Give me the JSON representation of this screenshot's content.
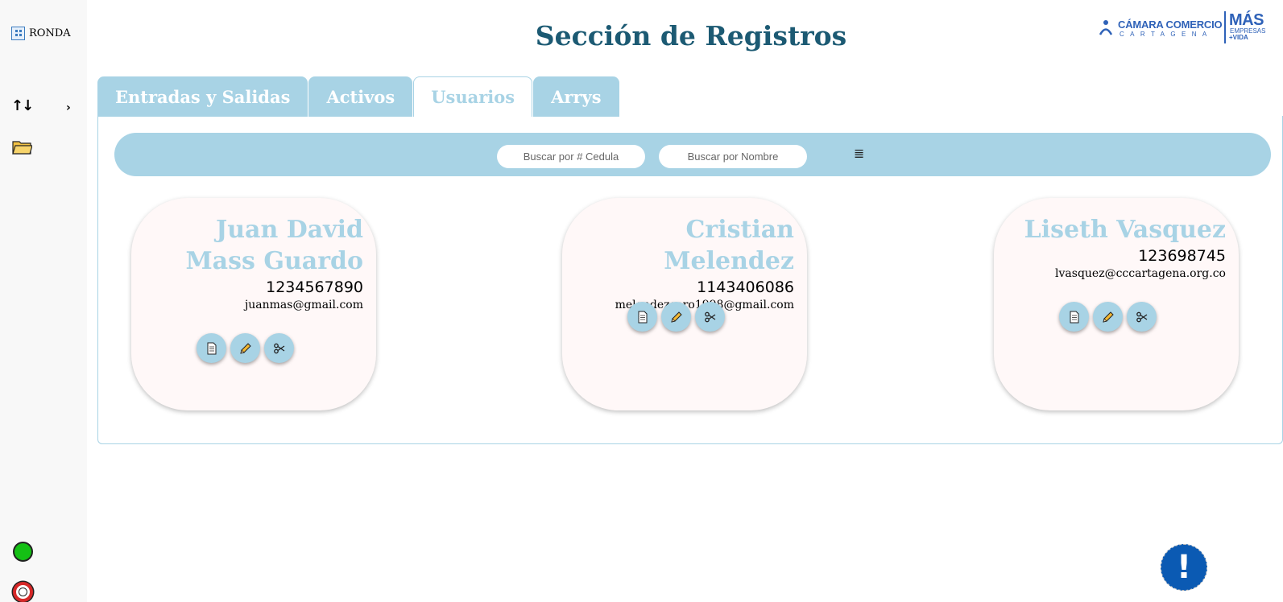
{
  "app": {
    "brand": "RONDA"
  },
  "header": {
    "title": "Sección de Registros"
  },
  "logo": {
    "line1": "CÁMARA COMERCIO",
    "line2": "CARTAGENA",
    "mas": "MÁS",
    "empresas": "EMPRESAS",
    "vida": "+VIDA"
  },
  "sidebar": {
    "items": [
      {
        "icon": "up-down-arrows-icon",
        "chevron": "›"
      },
      {
        "icon": "folder-icon"
      }
    ],
    "status": [
      {
        "icon": "status-green-icon",
        "color": "#14c014"
      },
      {
        "icon": "record-icon",
        "color": "#d62828"
      }
    ]
  },
  "tabs": [
    {
      "label": "Entradas y Salidas",
      "active": false
    },
    {
      "label": "Activos",
      "active": false
    },
    {
      "label": "Usuarios",
      "active": true
    },
    {
      "label": "Arrys",
      "active": false
    }
  ],
  "search": {
    "cedula_placeholder": "Buscar por # Cedula",
    "nombre_placeholder": "Buscar por Nombre",
    "filter_icon": "≣"
  },
  "users": [
    {
      "name": "Juan David Mass Guardo",
      "id": "1234567890",
      "email": "juanmas@gmail.com"
    },
    {
      "name": "Cristian Melendez",
      "id": "1143406086",
      "email": "melendezcaro1998@gmail.com"
    },
    {
      "name": "Liseth Vasquez",
      "id": "123698745",
      "email": "lvasquez@cccartagena.org.co"
    }
  ],
  "alert": {
    "label": "!"
  },
  "colors": {
    "accent": "#a8d3e5",
    "title": "#1c5a73",
    "brand": "#2f62b8",
    "alert": "#0b5ab3"
  }
}
